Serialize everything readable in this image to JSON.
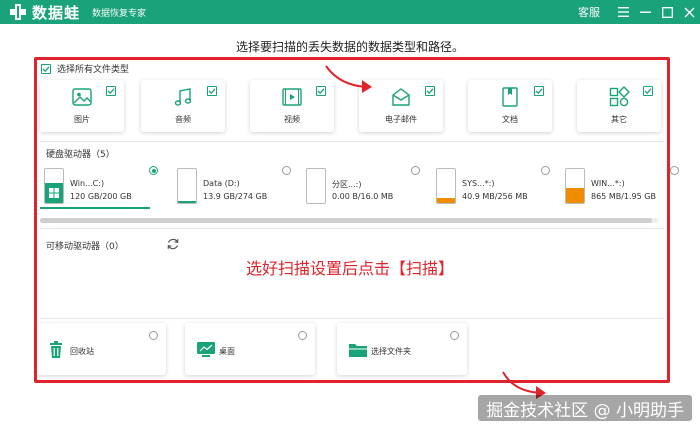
{
  "app": {
    "name": "数据蛙",
    "subtitle": "数据恢复专家",
    "service": "客服",
    "brand_color": "#1aa37a"
  },
  "instruction": "选择要扫描的丢失数据的数据类型和路径。",
  "select_all": {
    "label": "选择所有文件类型",
    "checked": true
  },
  "file_types": [
    {
      "label": "图片",
      "icon": "image-icon",
      "checked": true
    },
    {
      "label": "音频",
      "icon": "music-icon",
      "checked": true
    },
    {
      "label": "视频",
      "icon": "video-icon",
      "checked": true
    },
    {
      "label": "电子邮件",
      "icon": "email-icon",
      "checked": true
    },
    {
      "label": "文档",
      "icon": "document-icon",
      "checked": true
    },
    {
      "label": "其它",
      "icon": "other-icon",
      "checked": true
    }
  ],
  "hard_drives": {
    "title": "硬盘驱动器（5）",
    "items": [
      {
        "name": "Win...C:)",
        "size": "120 GB/200 GB",
        "used": 0.6,
        "selected": true,
        "color": "#1aa37a"
      },
      {
        "name": "Data (D:)",
        "size": "13.9 GB/274 GB",
        "used": 0.05,
        "selected": false,
        "color": "#1aa37a"
      },
      {
        "name": "分区...:)",
        "size": "0.00  B/16.0 MB",
        "used": 0.0,
        "selected": false,
        "color": "#1aa37a"
      },
      {
        "name": "SYS...*:)",
        "size": "40.9 MB/256 MB",
        "used": 0.16,
        "selected": false,
        "color": "#f08c00"
      },
      {
        "name": "WIN...*:)",
        "size": "865 MB/1.95 GB",
        "used": 0.43,
        "selected": false,
        "color": "#f08c00"
      }
    ]
  },
  "removable": {
    "title": "可移动驱动器（0）"
  },
  "annotation": "选好扫描设置后点击【扫描】",
  "locations": [
    {
      "label": "回收站",
      "icon": "trash-icon"
    },
    {
      "label": "桌面",
      "icon": "desktop-icon"
    },
    {
      "label": "选择文件夹",
      "icon": "folder-icon"
    }
  ],
  "watermark": "掘金技术社区 @ 小明助手"
}
